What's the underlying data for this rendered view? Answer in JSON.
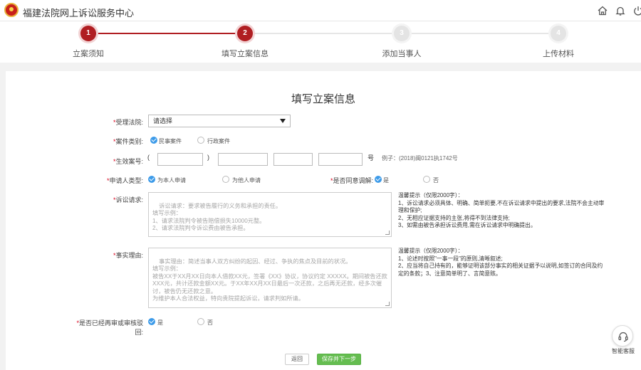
{
  "header": {
    "title": "福建法院网上诉讼服务中心",
    "icons": [
      "home-icon",
      "bell-icon",
      "power-icon"
    ]
  },
  "steps": [
    {
      "num": "1",
      "label": "立案须知",
      "state": "done"
    },
    {
      "num": "2",
      "label": "填写立案信息",
      "state": "current"
    },
    {
      "num": "3",
      "label": "添加当事人",
      "state": "todo"
    },
    {
      "num": "4",
      "label": "上传材料",
      "state": "todo"
    }
  ],
  "form": {
    "title": "填写立案信息",
    "court": {
      "label": "受理法院:",
      "value": "请选择"
    },
    "case_type": {
      "label": "案件类别:",
      "options": [
        "民事案件",
        "行政案件"
      ],
      "selected": "民事案件"
    },
    "case_no": {
      "label": "生效案号:",
      "open_paren": "(",
      "close_paren": ")",
      "suffix": "号",
      "example": "例子：(2018)闽0121执1742号"
    },
    "applicant_type": {
      "label": "申请人类型:",
      "options": [
        "为本人申请",
        "为他人申请"
      ],
      "selected": "为本人申请"
    },
    "mediation": {
      "label": "是否同意调解:",
      "options": [
        "是",
        "否"
      ],
      "selected": "是"
    },
    "claim": {
      "label": "诉讼请求:",
      "placeholder": "诉讼请求：要求被告履行的义务和承担的责任。\n填写示例：\n1、请求法院判令被告赔偿损失10000元整。\n2、请求法院判令诉讼费由被告承担。"
    },
    "claim_tip": "温馨提示（仅限2000字）：\n1、诉讼请求必须具体、明确、简单扼要,不在诉讼请求中提出的要求,法院不会主动审理和保护;\n2、无相应证据支持的主张,将得不到法律支持;\n3、如需由被告承担诉讼费用,需在诉讼请求中明确提出。",
    "reason": {
      "label": "事实理由:",
      "placeholder": "事实理由：简述当事人双方纠纷的起因、经过、争执的焦点及目前的状况。\n填写示例：\n被告XX于XX月XX日向本人借款XX元，签署《XX》协议，协议约定 XXXXX。期间被告还款XXX元，共计还款金额XX元。于XX年XX月XX日最后一次还款，之后再无还款，经多次催讨，被告仍无还款之意。\n为维护本人合法权益，特向贵院提起诉讼，请求判如所请。"
    },
    "reason_tip": "温馨提示（仅限2000字）：\n1、论述时按照\"一事一段\"的原则,清晰叙述;\n2、应当将自己持有的，能够证明该部分事实的相关证据予以说明,如签订的合同及约定的条款；3、注意简单明了、言简意赅。",
    "retrial": {
      "label": "是否已经再审或审核驳回:",
      "options": [
        "是",
        "否"
      ],
      "selected": "是"
    }
  },
  "buttons": {
    "back": "返回",
    "save": "保存并下一步"
  },
  "service": {
    "label": "智能客服"
  },
  "colors": {
    "step_active": "#b01e22",
    "check": "#3d9be9",
    "primary": "#65bd50",
    "required": "#d9001b"
  }
}
